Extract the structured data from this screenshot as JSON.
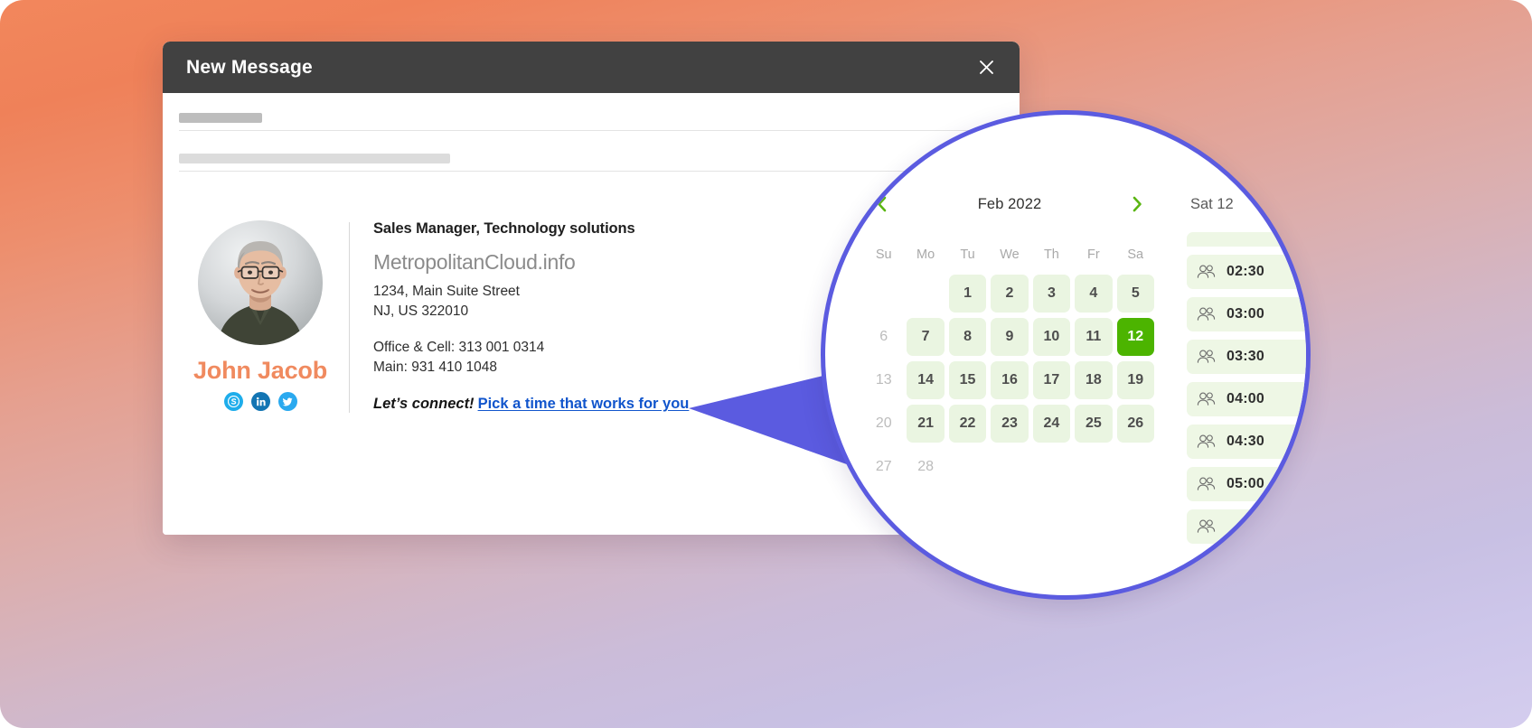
{
  "window": {
    "title": "New Message",
    "close_icon": "close-icon"
  },
  "compose": {
    "to_placeholder": "",
    "subject_placeholder": ""
  },
  "signature": {
    "name": "John Jacob",
    "role": "Sales Manager, Technology solutions",
    "company": "MetropolitanCloud.info",
    "address_line1": "1234, Main Suite Street",
    "address_line2": "NJ, US 322010",
    "phone_office": "Office & Cell: 313 001 0314",
    "phone_main": "Main: 931 410 1048",
    "cta_lead": "Let’s connect!",
    "cta_link": "Pick a time that works for you",
    "socials": [
      {
        "name": "skype",
        "label": "Skype",
        "color": "#1eadeb"
      },
      {
        "name": "linkedin",
        "label": "LinkedIn",
        "color": "#1375b3"
      },
      {
        "name": "twitter",
        "label": "Twitter",
        "color": "#2aa9ef"
      }
    ]
  },
  "calendar": {
    "month_label": "Feb 2022",
    "prev_icon": "chevron-left-icon",
    "next_icon": "chevron-right-icon",
    "accent_green": "#4cb400",
    "cell_green": "#eaf5e1",
    "weekdays": [
      "Su",
      "Mo",
      "Tu",
      "We",
      "Th",
      "Fr",
      "Sa"
    ],
    "weeks": [
      [
        {
          "label": "",
          "state": "empty"
        },
        {
          "label": "",
          "state": "empty"
        },
        {
          "label": "1",
          "state": "available"
        },
        {
          "label": "2",
          "state": "available"
        },
        {
          "label": "3",
          "state": "available"
        },
        {
          "label": "4",
          "state": "available"
        },
        {
          "label": "5",
          "state": "available"
        }
      ],
      [
        {
          "label": "6",
          "state": "disabled"
        },
        {
          "label": "7",
          "state": "available"
        },
        {
          "label": "8",
          "state": "available"
        },
        {
          "label": "9",
          "state": "available"
        },
        {
          "label": "10",
          "state": "available"
        },
        {
          "label": "11",
          "state": "available"
        },
        {
          "label": "12",
          "state": "selected"
        }
      ],
      [
        {
          "label": "13",
          "state": "disabled"
        },
        {
          "label": "14",
          "state": "available"
        },
        {
          "label": "15",
          "state": "available"
        },
        {
          "label": "16",
          "state": "available"
        },
        {
          "label": "17",
          "state": "available"
        },
        {
          "label": "18",
          "state": "available"
        },
        {
          "label": "19",
          "state": "available"
        }
      ],
      [
        {
          "label": "20",
          "state": "disabled"
        },
        {
          "label": "21",
          "state": "available"
        },
        {
          "label": "22",
          "state": "available"
        },
        {
          "label": "23",
          "state": "available"
        },
        {
          "label": "24",
          "state": "available"
        },
        {
          "label": "25",
          "state": "available"
        },
        {
          "label": "26",
          "state": "available"
        }
      ],
      [
        {
          "label": "27",
          "state": "disabled"
        },
        {
          "label": "28",
          "state": "disabled"
        },
        {
          "label": "",
          "state": "empty"
        },
        {
          "label": "",
          "state": "empty"
        },
        {
          "label": "",
          "state": "empty"
        },
        {
          "label": "",
          "state": "empty"
        },
        {
          "label": "",
          "state": "empty"
        }
      ]
    ]
  },
  "slots": {
    "header": "Sat 12",
    "icon": "people-icon",
    "items": [
      {
        "time": "",
        "partial": true
      },
      {
        "time": "02:30",
        "partial": false
      },
      {
        "time": "03:00",
        "partial": false
      },
      {
        "time": "03:30",
        "partial": false
      },
      {
        "time": "04:00",
        "partial": false
      },
      {
        "time": "04:30",
        "partial": false
      },
      {
        "time": "05:00",
        "partial": false
      },
      {
        "time": "",
        "partial": false
      }
    ]
  }
}
